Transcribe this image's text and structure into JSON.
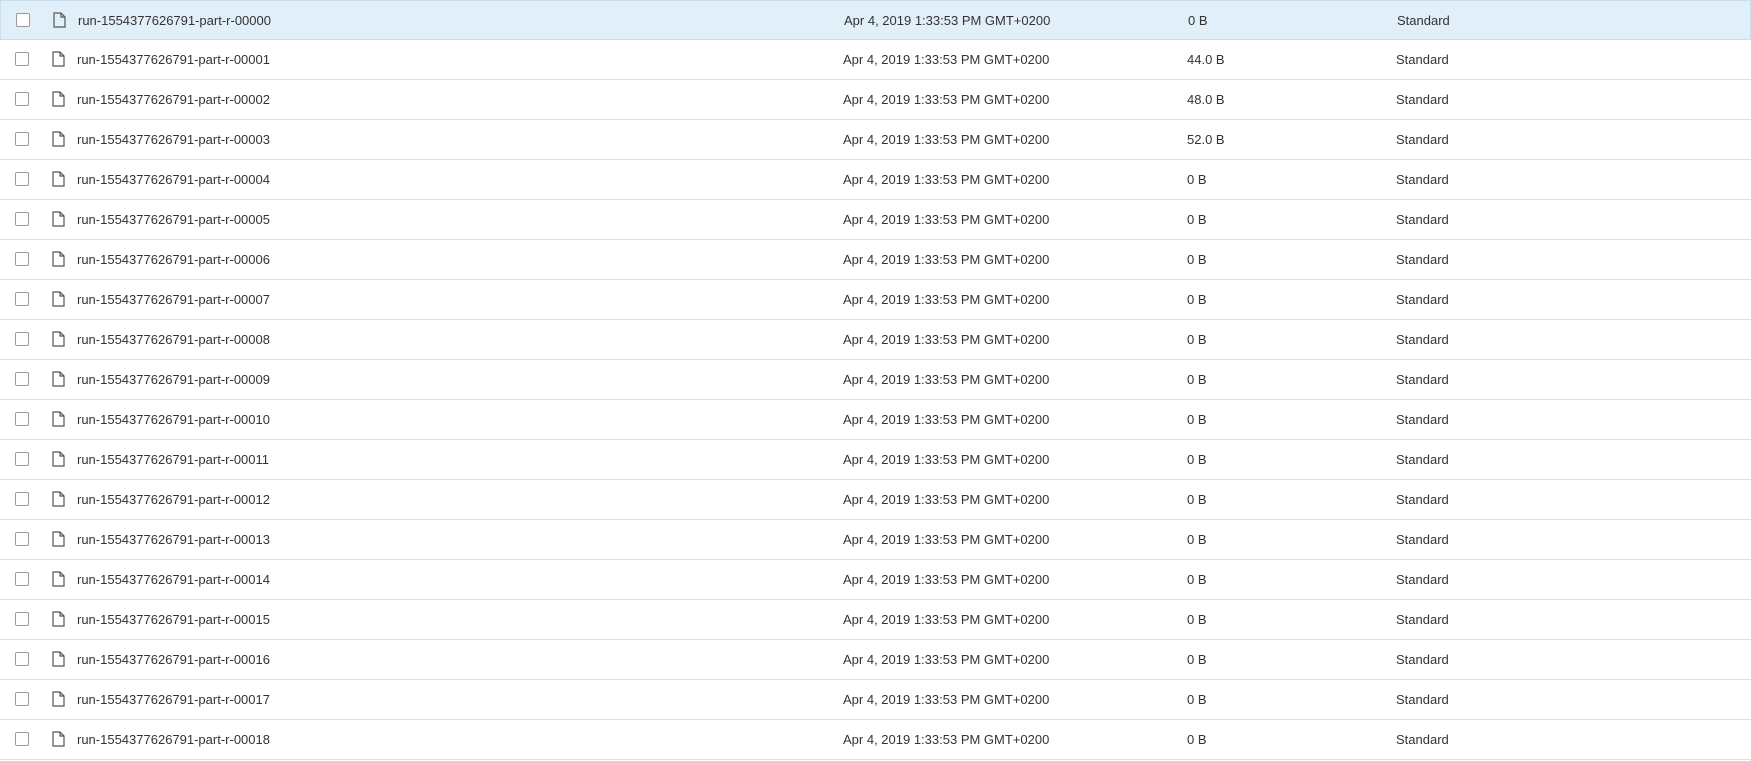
{
  "file_icon": "file-icon",
  "colors": {
    "selected_row_bg": "#e1eff9",
    "row_divider": "#e0e0e0",
    "text": "#333333"
  },
  "rows": [
    {
      "name": "run-1554377626791-part-r-00000",
      "date": "Apr 4, 2019 1:33:53 PM GMT+0200",
      "size": "0 B",
      "storage_class": "Standard",
      "selected": true
    },
    {
      "name": "run-1554377626791-part-r-00001",
      "date": "Apr 4, 2019 1:33:53 PM GMT+0200",
      "size": "44.0 B",
      "storage_class": "Standard"
    },
    {
      "name": "run-1554377626791-part-r-00002",
      "date": "Apr 4, 2019 1:33:53 PM GMT+0200",
      "size": "48.0 B",
      "storage_class": "Standard"
    },
    {
      "name": "run-1554377626791-part-r-00003",
      "date": "Apr 4, 2019 1:33:53 PM GMT+0200",
      "size": "52.0 B",
      "storage_class": "Standard"
    },
    {
      "name": "run-1554377626791-part-r-00004",
      "date": "Apr 4, 2019 1:33:53 PM GMT+0200",
      "size": "0 B",
      "storage_class": "Standard"
    },
    {
      "name": "run-1554377626791-part-r-00005",
      "date": "Apr 4, 2019 1:33:53 PM GMT+0200",
      "size": "0 B",
      "storage_class": "Standard"
    },
    {
      "name": "run-1554377626791-part-r-00006",
      "date": "Apr 4, 2019 1:33:53 PM GMT+0200",
      "size": "0 B",
      "storage_class": "Standard"
    },
    {
      "name": "run-1554377626791-part-r-00007",
      "date": "Apr 4, 2019 1:33:53 PM GMT+0200",
      "size": "0 B",
      "storage_class": "Standard"
    },
    {
      "name": "run-1554377626791-part-r-00008",
      "date": "Apr 4, 2019 1:33:53 PM GMT+0200",
      "size": "0 B",
      "storage_class": "Standard"
    },
    {
      "name": "run-1554377626791-part-r-00009",
      "date": "Apr 4, 2019 1:33:53 PM GMT+0200",
      "size": "0 B",
      "storage_class": "Standard"
    },
    {
      "name": "run-1554377626791-part-r-00010",
      "date": "Apr 4, 2019 1:33:53 PM GMT+0200",
      "size": "0 B",
      "storage_class": "Standard"
    },
    {
      "name": "run-1554377626791-part-r-00011",
      "date": "Apr 4, 2019 1:33:53 PM GMT+0200",
      "size": "0 B",
      "storage_class": "Standard"
    },
    {
      "name": "run-1554377626791-part-r-00012",
      "date": "Apr 4, 2019 1:33:53 PM GMT+0200",
      "size": "0 B",
      "storage_class": "Standard"
    },
    {
      "name": "run-1554377626791-part-r-00013",
      "date": "Apr 4, 2019 1:33:53 PM GMT+0200",
      "size": "0 B",
      "storage_class": "Standard"
    },
    {
      "name": "run-1554377626791-part-r-00014",
      "date": "Apr 4, 2019 1:33:53 PM GMT+0200",
      "size": "0 B",
      "storage_class": "Standard"
    },
    {
      "name": "run-1554377626791-part-r-00015",
      "date": "Apr 4, 2019 1:33:53 PM GMT+0200",
      "size": "0 B",
      "storage_class": "Standard"
    },
    {
      "name": "run-1554377626791-part-r-00016",
      "date": "Apr 4, 2019 1:33:53 PM GMT+0200",
      "size": "0 B",
      "storage_class": "Standard"
    },
    {
      "name": "run-1554377626791-part-r-00017",
      "date": "Apr 4, 2019 1:33:53 PM GMT+0200",
      "size": "0 B",
      "storage_class": "Standard"
    },
    {
      "name": "run-1554377626791-part-r-00018",
      "date": "Apr 4, 2019 1:33:53 PM GMT+0200",
      "size": "0 B",
      "storage_class": "Standard"
    }
  ]
}
